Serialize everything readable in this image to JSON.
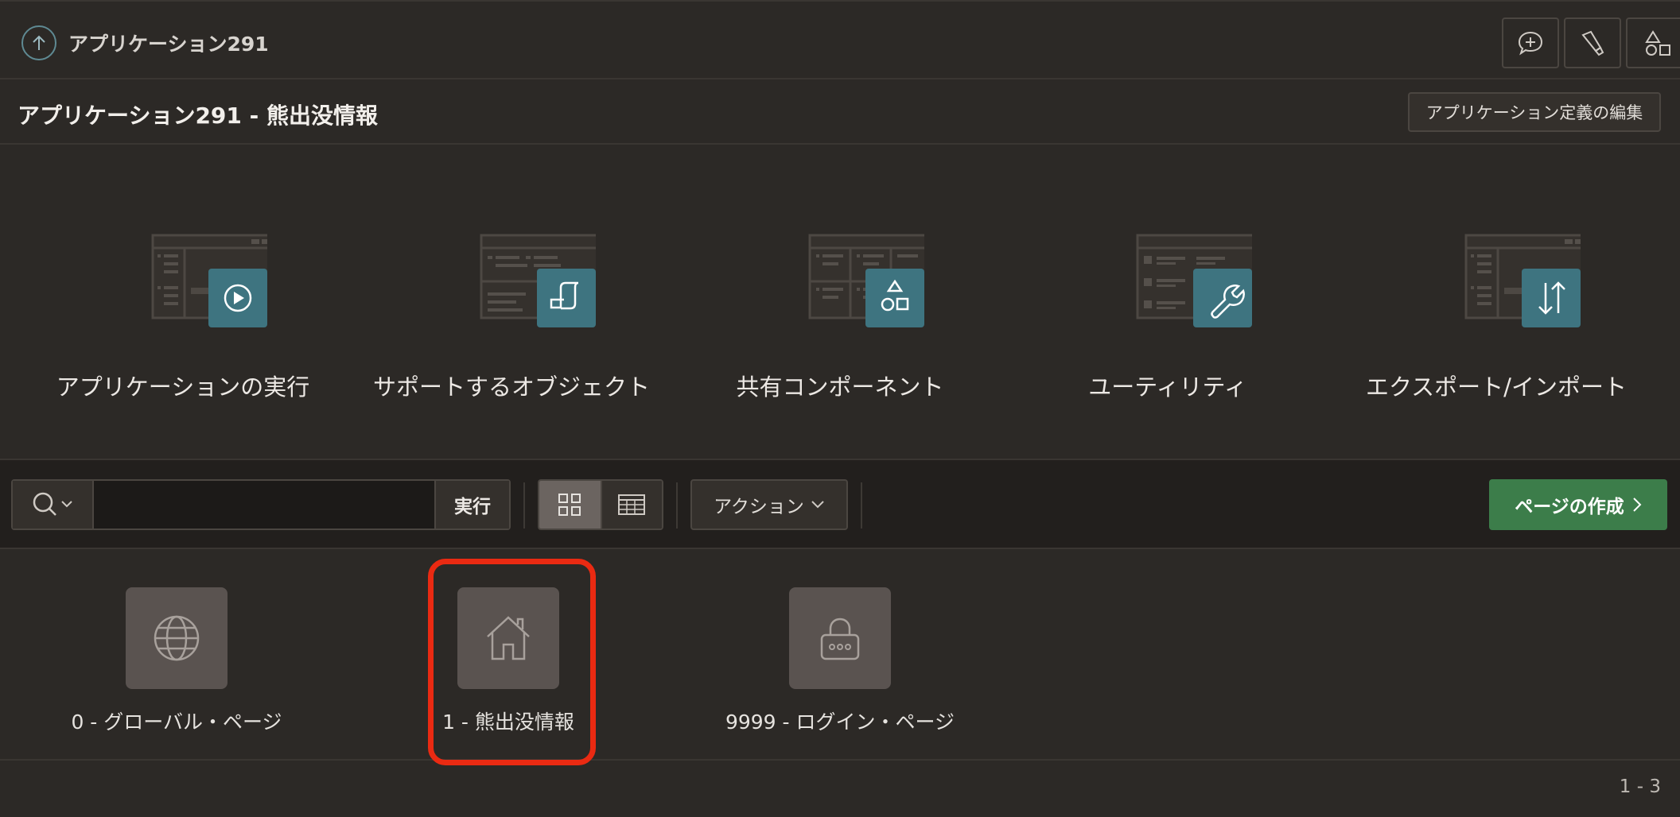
{
  "topbar": {
    "app_link": "アプリケーション291",
    "buttons": [
      {
        "icon": "chat-plus-icon"
      },
      {
        "icon": "flashlight-icon"
      },
      {
        "icon": "shapes-icon"
      }
    ]
  },
  "header": {
    "title": "アプリケーション291 - 熊出没情報",
    "edit_button": "アプリケーション定義の編集"
  },
  "tiles": [
    {
      "label": "アプリケーションの実行",
      "icon": "play-icon"
    },
    {
      "label": "サポートするオブジェクト",
      "icon": "scroll-icon"
    },
    {
      "label": "共有コンポーネント",
      "icon": "shapes-icon"
    },
    {
      "label": "ユーティリティ",
      "icon": "wrench-icon"
    },
    {
      "label": "エクスポート/インポート",
      "icon": "up-down-arrows-icon"
    }
  ],
  "toolbar": {
    "search_value": "",
    "go_button": "実行",
    "actions_button": "アクション",
    "create_button": "ページの作成"
  },
  "pages": [
    {
      "label": "0 - グローバル・ページ",
      "icon": "globe-icon"
    },
    {
      "label": "1 - 熊出没情報",
      "icon": "home-icon"
    },
    {
      "label": "9999 - ログイン・ページ",
      "icon": "lock-icon"
    }
  ],
  "pagination": "1 - 3",
  "colors": {
    "background": "#2c2926",
    "accent_teal": "#3e7480",
    "create_green": "#3c7d4a",
    "highlight_red": "#ea2a12"
  }
}
